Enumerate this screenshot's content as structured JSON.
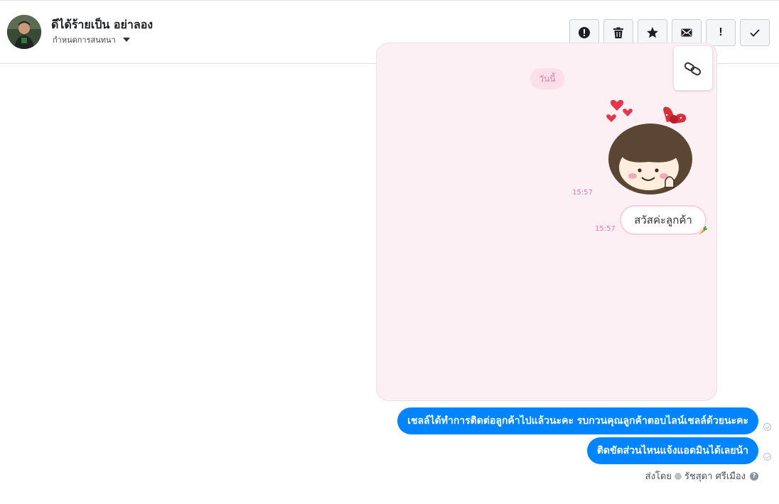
{
  "header": {
    "contact_name": "ดีได้ร้ายเป็น อย่าลอง",
    "assign_label": "กำหนดการสนทนา",
    "toolbar": [
      {
        "icon": "alert-circle-icon",
        "text": ""
      },
      {
        "icon": "trash-icon",
        "text": ""
      },
      {
        "icon": "star-icon",
        "text": ""
      },
      {
        "icon": "envelope-icon",
        "text": ""
      },
      {
        "icon": "exclamation-icon",
        "text": "!"
      },
      {
        "icon": "checkmark-icon",
        "text": ""
      }
    ]
  },
  "media": {
    "date_label": "วันนี้",
    "sticker_time": "15:57",
    "message_time": "15:57",
    "message_text": "สวัสค่ะลูกค้า"
  },
  "messages": [
    {
      "text": "เชลล์ได้ทำการติดต่อลูกค้าไปแล้วนะคะ รบกวนคุณลูกค้าตอบไลน์เชลล์ด้วยนะคะ"
    },
    {
      "text": "ติดขัดส่วนไหนแจ้งแอดมินได้เลยน้า"
    }
  ],
  "footer": {
    "sent_by_label": "ส่งโดย",
    "sender_name": "รัชสุดา ศรีเมือง",
    "help_icon_text": "?"
  },
  "colors": {
    "bubble": "#0084ff",
    "card_bg": "#fdf0f5",
    "pink_text": "#e77aa6"
  }
}
